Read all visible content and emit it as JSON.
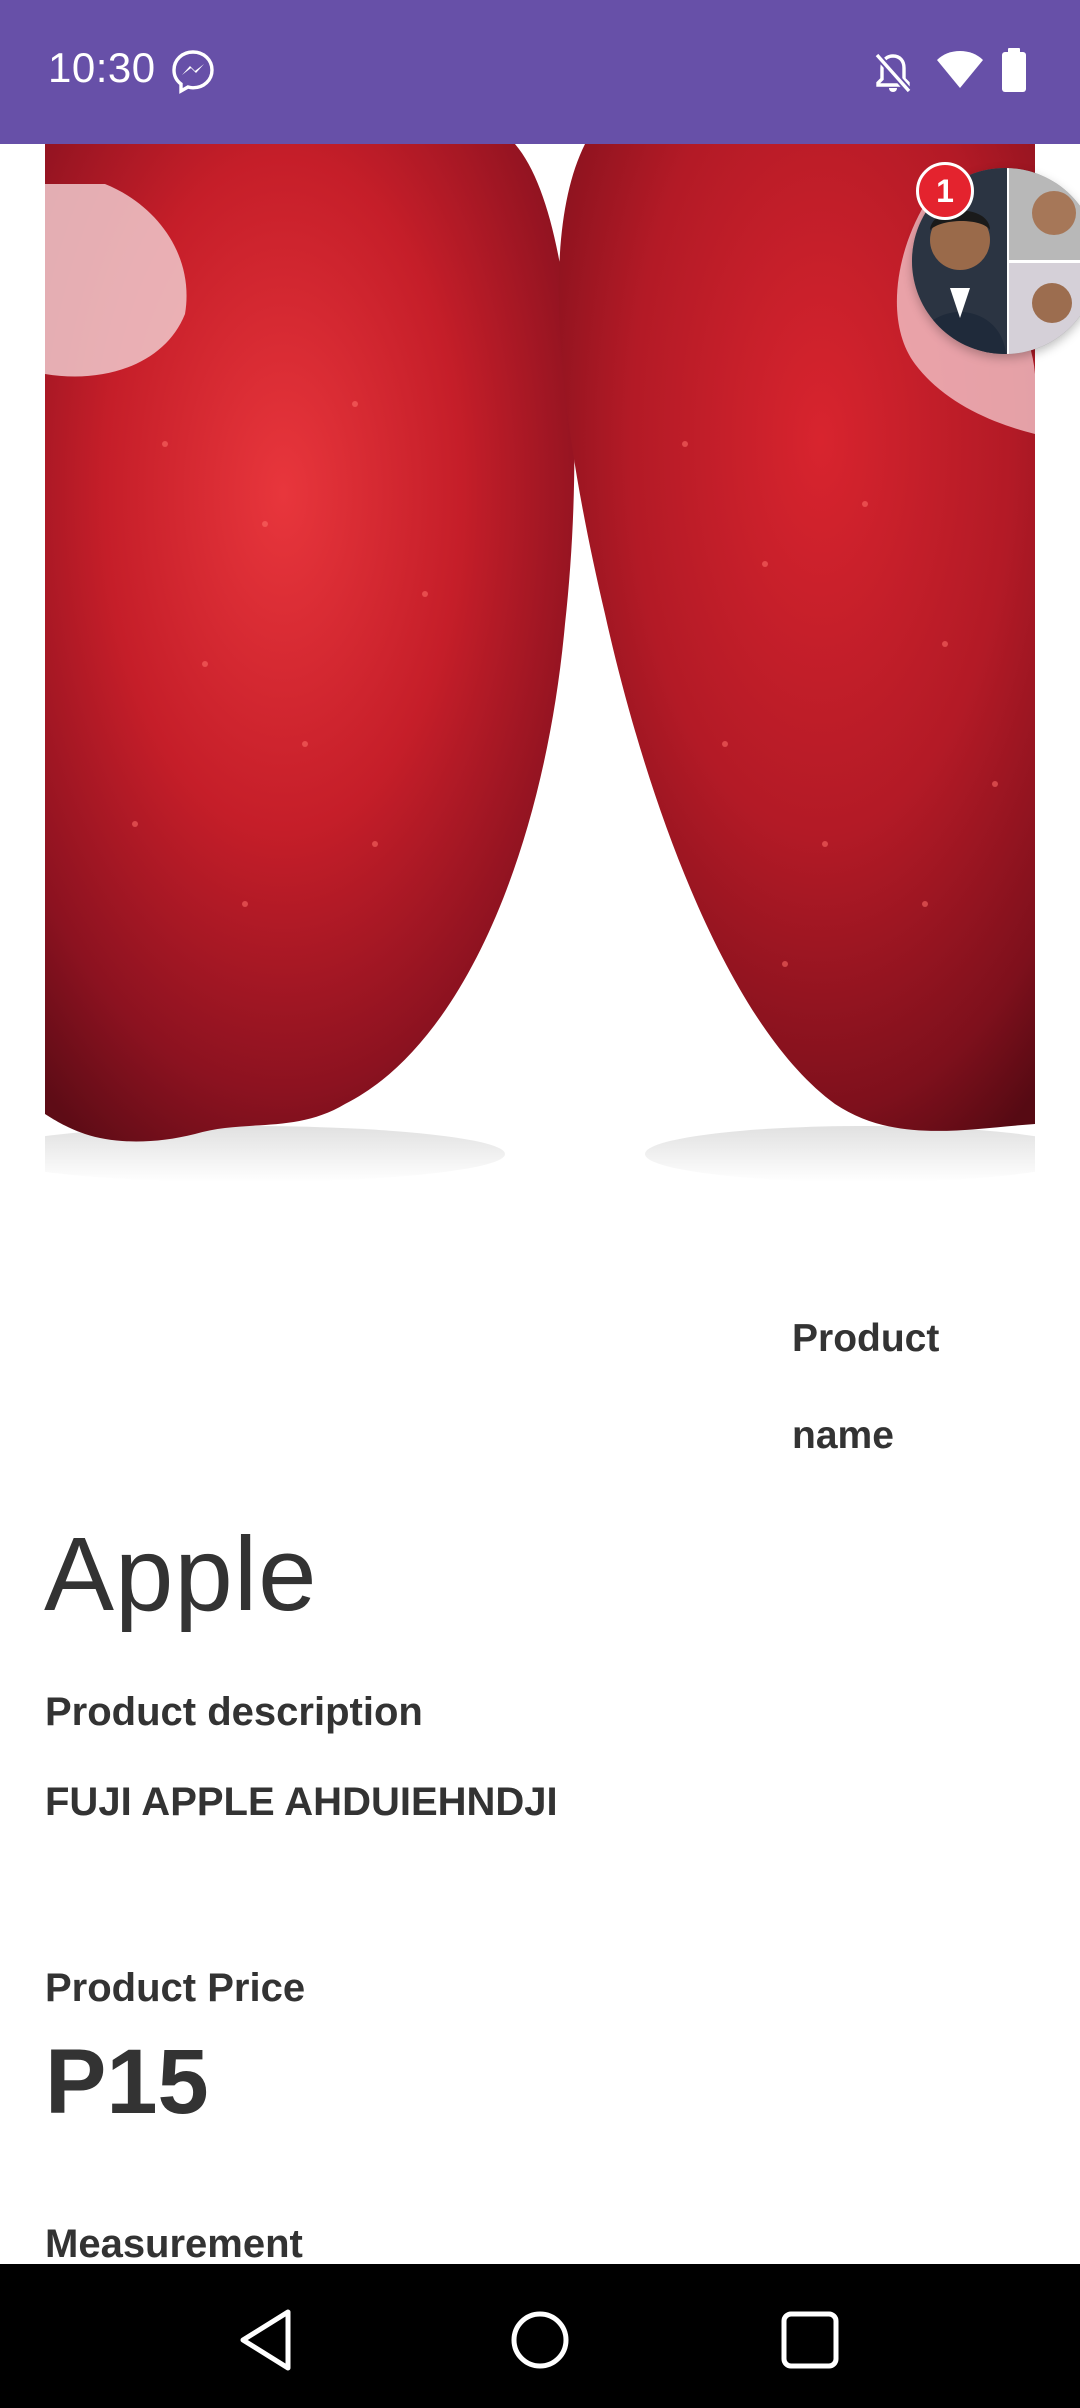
{
  "status_bar": {
    "time": "10:30",
    "icons": [
      "messenger-icon",
      "notifications-off-icon",
      "wifi-icon",
      "battery-icon"
    ]
  },
  "product_image": {
    "subject": "apple-photo"
  },
  "chat_head": {
    "badge_count": "1"
  },
  "product": {
    "name_label": "Product name",
    "name": "Apple",
    "description_label": "Product description",
    "description": "FUJI APPLE AHDUIEHNDJI",
    "price_label": "Product Price",
    "price": "P15",
    "measurement_label": "Measurement"
  },
  "nav_bar": {
    "buttons": [
      "back-icon",
      "home-icon",
      "recents-icon"
    ]
  },
  "colors": {
    "status_bar": "#6750a8",
    "text": "#333333",
    "badge": "#e4232e",
    "nav_bar": "#000000"
  }
}
